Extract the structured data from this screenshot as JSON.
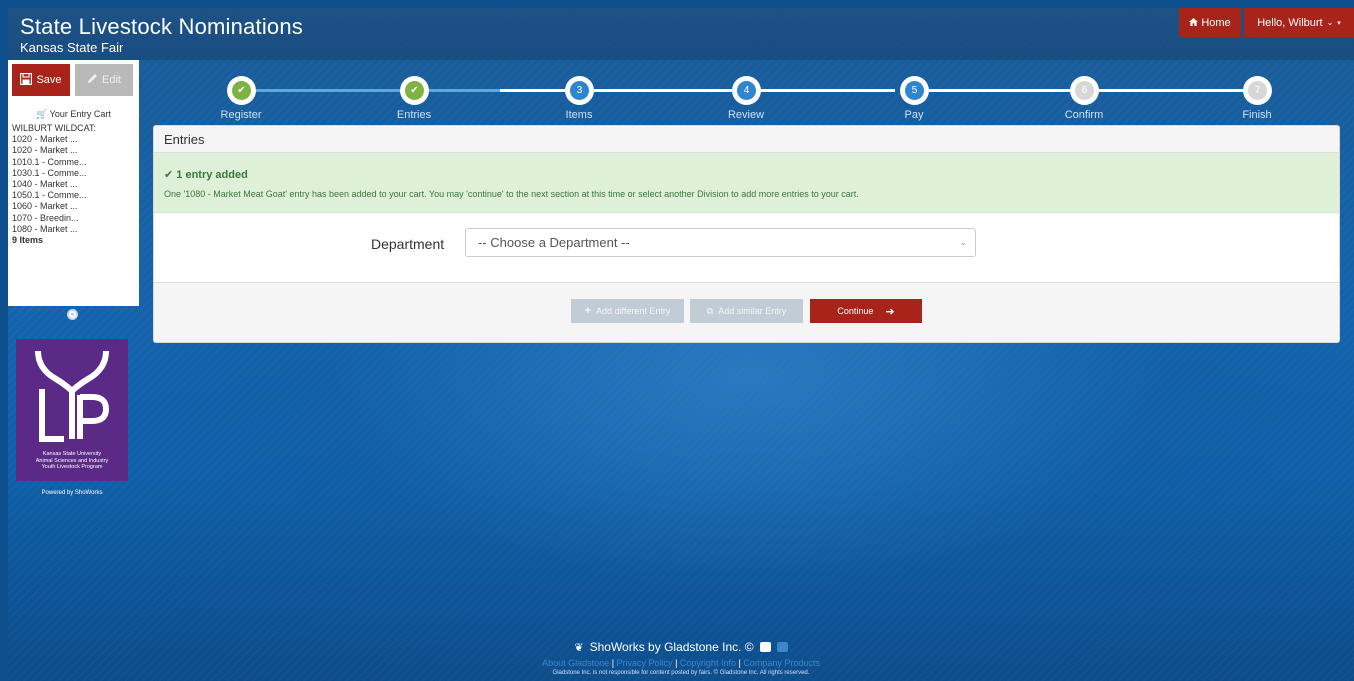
{
  "header": {
    "title": "State Livestock Nominations",
    "subtitle": "Kansas State Fair",
    "home_label": "Home",
    "user_label": "Hello, Wilburt"
  },
  "sidebar": {
    "save_label": "Save",
    "edit_label": "Edit",
    "cart_heading": "Your Entry Cart",
    "cart_owner": "WILBURT WILDCAT:",
    "cart_items": [
      "1020 - Market ...",
      "1020 - Market ...",
      "1010.1 - Comme...",
      "1030.1 - Comme...",
      "1040 - Market ...",
      "1050.1 - Comme...",
      "1060 - Market ...",
      "1070 - Breedin...",
      "1080 - Market ..."
    ],
    "cart_count": "9 Items",
    "logo_text": "Kansas State University\nAnimal Sciences and Industry\nYouth Livestock Program",
    "logo_letters": "LYP",
    "powered_by": "Powered by ShoWorks"
  },
  "steps": [
    {
      "num": "1",
      "label": "Register",
      "status": "done"
    },
    {
      "num": "2",
      "label": "Entries",
      "status": "done"
    },
    {
      "num": "3",
      "label": "Items",
      "status": "active"
    },
    {
      "num": "4",
      "label": "Review",
      "status": "active"
    },
    {
      "num": "5",
      "label": "Pay",
      "status": "active"
    },
    {
      "num": "6",
      "label": "Confirm",
      "status": "pending"
    },
    {
      "num": "7",
      "label": "Finish",
      "status": "pending"
    }
  ],
  "panel": {
    "heading": "Entries",
    "alert_title": "1 entry added",
    "alert_message": "One '1080 - Market Meat Goat' entry has been added to your cart. You may 'continue' to the next section at this time or select another Division to add more entries to your cart.",
    "department_label": "Department",
    "department_value": "-- Choose a Department --",
    "add_different_label": "Add different Entry",
    "add_similar_label": "Add similar Entry",
    "continue_label": "Continue"
  },
  "footer": {
    "brand": "ShoWorks by Gladstone Inc. ©",
    "links": [
      "About Gladstone",
      "Privacy Policy",
      "Copyright Info",
      "Company Products"
    ],
    "legal": "Gladstone Inc. is not responsible for content posted by fairs. © Gladstone Inc. All rights reserved."
  },
  "colors": {
    "brand_red": "#a8241b",
    "step_done": "#7cb342",
    "step_active": "#2f86d0",
    "step_pending": "#d7d7d7",
    "alert_bg": "#dff0d8"
  }
}
